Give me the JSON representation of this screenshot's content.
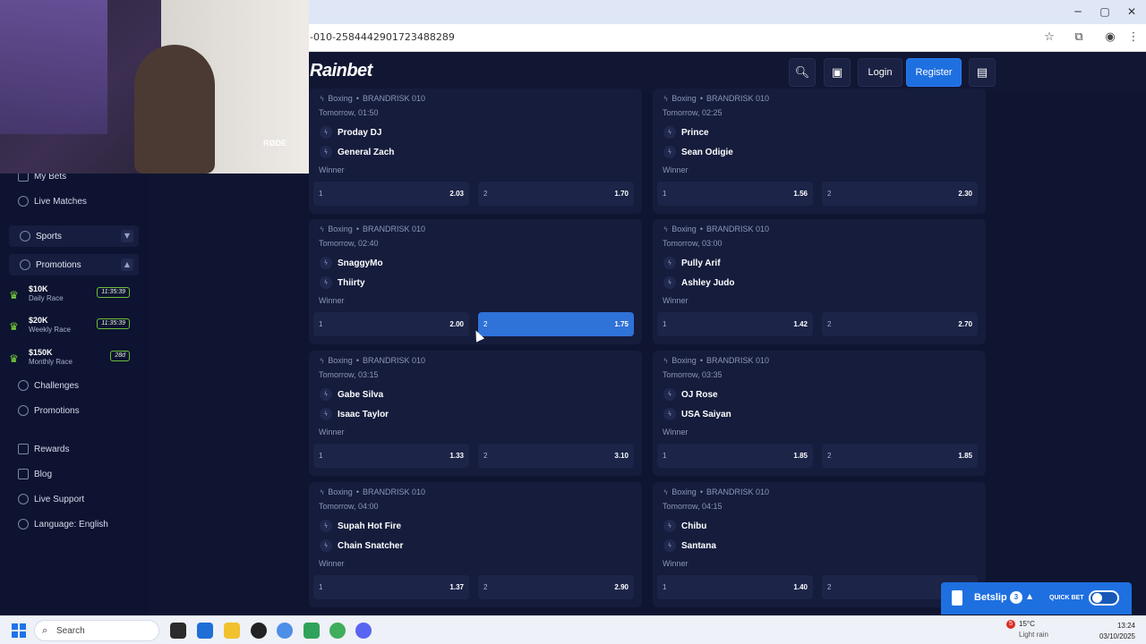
{
  "browser": {
    "url": "-010-2584442901723488289",
    "window_controls": [
      "─",
      "▢",
      "✕"
    ]
  },
  "site": {
    "logo": "Rainbet",
    "nav": {
      "login_label": "Login",
      "register_label": "Register"
    },
    "colors": {
      "accent": "#1e6fe0",
      "bg": "#0f1530",
      "card": "#151c3c"
    }
  },
  "sidebar": {
    "my_bets": "My Bets",
    "live_matches": "Live Matches",
    "sports": "Sports",
    "promotions": "Promotions",
    "races": [
      {
        "amount": "$10K",
        "label": "Daily Race",
        "timer": "11:35:39"
      },
      {
        "amount": "$20K",
        "label": "Weekly Race",
        "timer": "11:35:39"
      },
      {
        "amount": "$150K",
        "label": "Monthly Race",
        "timer": "28d"
      }
    ],
    "challenges": "Challenges",
    "promotions_link": "Promotions",
    "rewards": "Rewards",
    "blog": "Blog",
    "live_support": "Live Support",
    "language": "Language: English"
  },
  "webcam": {
    "mic_label": "RØDE"
  },
  "events": [
    {
      "sport": "Boxing",
      "league": "BRANDRISK 010",
      "time": "Tomorrow, 01:50",
      "team1": "Proday DJ",
      "team2": "General Zach",
      "market": "Winner",
      "odds": [
        {
          "sel": "1",
          "price": "2.03"
        },
        {
          "sel": "2",
          "price": "1.70"
        }
      ]
    },
    {
      "sport": "Boxing",
      "league": "BRANDRISK 010",
      "time": "Tomorrow, 02:25",
      "team1": "Prince",
      "team2": "Sean Odigie",
      "market": "Winner",
      "odds": [
        {
          "sel": "1",
          "price": "1.56"
        },
        {
          "sel": "2",
          "price": "2.30"
        }
      ]
    },
    {
      "sport": "Boxing",
      "league": "BRANDRISK 010",
      "time": "Tomorrow, 02:40",
      "team1": "SnaggyMo",
      "team2": "Thiirty",
      "market": "Winner",
      "odds": [
        {
          "sel": "1",
          "price": "2.00"
        },
        {
          "sel": "2",
          "price": "1.75"
        }
      ]
    },
    {
      "sport": "Boxing",
      "league": "BRANDRISK 010",
      "time": "Tomorrow, 03:00",
      "team1": "Pully Arif",
      "team2": "Ashley Judo",
      "market": "Winner",
      "odds": [
        {
          "sel": "1",
          "price": "1.42"
        },
        {
          "sel": "2",
          "price": "2.70"
        }
      ]
    },
    {
      "sport": "Boxing",
      "league": "BRANDRISK 010",
      "time": "Tomorrow, 03:15",
      "team1": "Gabe Silva",
      "team2": "Isaac Taylor",
      "market": "Winner",
      "odds": [
        {
          "sel": "1",
          "price": "1.33"
        },
        {
          "sel": "2",
          "price": "3.10"
        }
      ]
    },
    {
      "sport": "Boxing",
      "league": "BRANDRISK 010",
      "time": "Tomorrow, 03:35",
      "team1": "OJ Rose",
      "team2": "USA Saiyan",
      "market": "Winner",
      "odds": [
        {
          "sel": "1",
          "price": "1.85"
        },
        {
          "sel": "2",
          "price": "1.85"
        }
      ]
    },
    {
      "sport": "Boxing",
      "league": "BRANDRISK 010",
      "time": "Tomorrow, 04:00",
      "team1": "Supah Hot Fire",
      "team2": "Chain Snatcher",
      "market": "Winner",
      "odds": [
        {
          "sel": "1",
          "price": "1.37"
        },
        {
          "sel": "2",
          "price": "2.90"
        }
      ]
    },
    {
      "sport": "Boxing",
      "league": "BRANDRISK 010",
      "time": "Tomorrow, 04:15",
      "team1": "Chibu",
      "team2": "Santana",
      "market": "Winner",
      "odds": [
        {
          "sel": "1",
          "price": "1.40"
        },
        {
          "sel": "2",
          "price": ""
        }
      ]
    }
  ],
  "betslip": {
    "label": "Betslip",
    "count": "3",
    "quick_bet_label": "QUICK BET"
  },
  "taskbar": {
    "search_placeholder": "Search",
    "weather_temp": "15°C",
    "weather_cond": "Light rain",
    "weather_badge": "5",
    "time": "13:24",
    "date": "03/10/2025"
  }
}
